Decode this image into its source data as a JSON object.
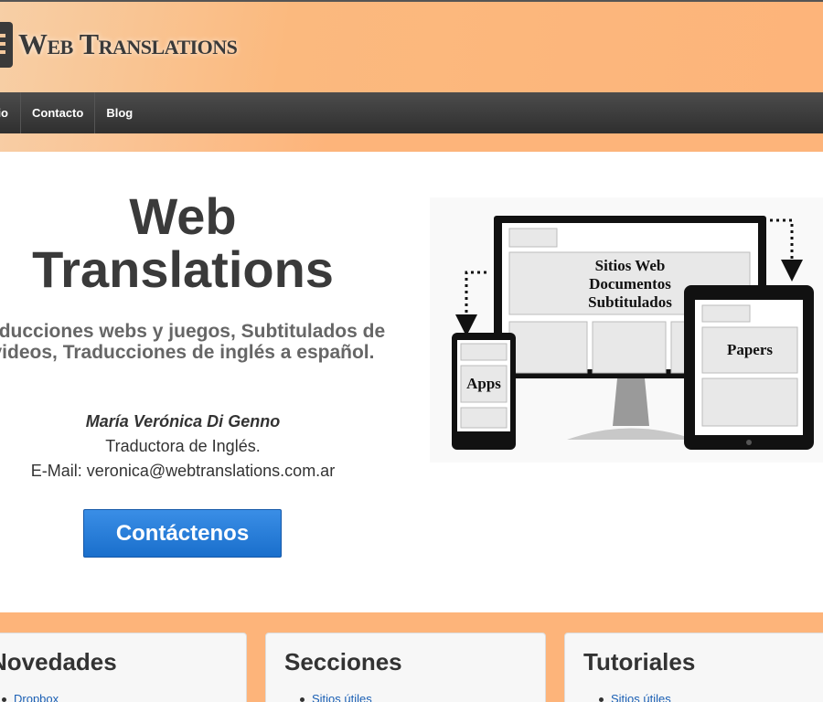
{
  "header": {
    "logo_text": "Web Translations"
  },
  "nav": {
    "items": [
      {
        "label": "io"
      },
      {
        "label": "Contacto"
      },
      {
        "label": "Blog"
      }
    ]
  },
  "hero": {
    "title": "Web Translations",
    "subtitle": "raducciones webs y juegos, Subtitulados de videos, Traducciones de inglés a español.",
    "name": "María Verónica Di Genno",
    "role": "Traductora de Inglés.",
    "email": "E-Mail: veronica@webtranslations.com.ar",
    "cta_label": "Contáctenos",
    "illustration": {
      "monitor_line1": "Sitios Web",
      "monitor_line2": "Documentos",
      "monitor_line3": "Subtitulados",
      "phone_label": "Apps",
      "tablet_label": "Papers"
    }
  },
  "panels": [
    {
      "title": "Novedades",
      "items": [
        "Dropbox"
      ]
    },
    {
      "title": "Secciones",
      "items": [
        "Sitios útiles"
      ]
    },
    {
      "title": "Tutoriales",
      "items": [
        "Sitios útiles"
      ]
    }
  ],
  "colors": {
    "page_background": "#fdb47a",
    "nav_background": "#3a3a3a",
    "cta_blue": "#2a7fd8",
    "link_blue": "#1a5fb4"
  }
}
